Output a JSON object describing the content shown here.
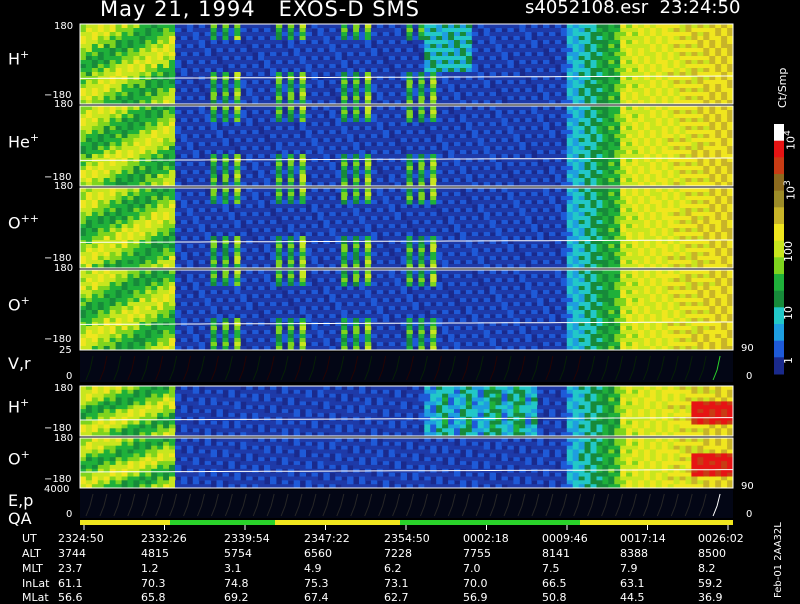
{
  "header": {
    "title": "May 21, 1994   EXOS-D SMS",
    "file_time": "s4052108.esr  23:24:50"
  },
  "colorbar": {
    "unit_label": "Ct/Smp",
    "tick_labels": [
      "1",
      "10",
      "100",
      "10",
      "10"
    ],
    "tick_exponents": [
      "",
      "",
      "",
      "3",
      "4"
    ],
    "colors": [
      "#1a2a8c",
      "#1e5ad8",
      "#1e9ee0",
      "#22c8c8",
      "#178a3a",
      "#1fb03a",
      "#7ed41e",
      "#c8e61e",
      "#f0e61e",
      "#c8b428",
      "#9c8c28",
      "#8c6a1e",
      "#c83c14",
      "#e61414",
      "#ffffff"
    ]
  },
  "panels": [
    {
      "label": "H",
      "sup": "+",
      "ymax": "180",
      "ymin": "−180"
    },
    {
      "label": "He",
      "sup": "+",
      "ymax": "180",
      "ymin": "−180"
    },
    {
      "label": "O",
      "sup": "++",
      "ymax": "180",
      "ymin": "−180"
    },
    {
      "label": "O",
      "sup": "+",
      "ymax": "180",
      "ymin": "−180"
    },
    {
      "label": "V,r",
      "sup": "",
      "ymax": "25",
      "ymin": "0",
      "right": "90",
      "right2": "0"
    },
    {
      "label": "H",
      "sup": "+",
      "ymax": "180",
      "ymin": "−180"
    },
    {
      "label": "O",
      "sup": "+",
      "ymax": "180",
      "ymin": "−180"
    },
    {
      "label": "E,p",
      "sup": "",
      "ymax": "4000",
      "ymin": "0",
      "right": "90",
      "right2": "0",
      "label2": "QA"
    }
  ],
  "table": {
    "row_labels": [
      "UT",
      "ALT",
      "MLT",
      "InLat",
      "MLat"
    ],
    "columns": [
      [
        "2324:50",
        "3744",
        "23.7",
        "61.1",
        "56.6"
      ],
      [
        "2332:26",
        "4815",
        "1.2",
        "70.3",
        "65.8"
      ],
      [
        "2339:54",
        "5754",
        "3.1",
        "74.8",
        "69.2"
      ],
      [
        "2347:22",
        "6560",
        "4.9",
        "75.3",
        "67.4"
      ],
      [
        "2354:50",
        "7228",
        "6.2",
        "73.1",
        "62.7"
      ],
      [
        "0002:18",
        "7755",
        "7.0",
        "70.0",
        "56.9"
      ],
      [
        "0009:46",
        "8141",
        "7.5",
        "66.5",
        "50.8"
      ],
      [
        "0017:14",
        "8388",
        "7.9",
        "63.1",
        "44.5"
      ],
      [
        "0026:02",
        "8500",
        "8.2",
        "59.2",
        "36.9"
      ]
    ]
  },
  "side_text": "Feb-01 2AA32L",
  "chart_data": {
    "type": "heatmap",
    "title": "May 21, 1994   EXOS-D SMS",
    "x": [
      "2324:50",
      "2332:26",
      "2339:54",
      "2347:22",
      "2354:50",
      "0002:18",
      "0009:46",
      "0017:14",
      "0026:02"
    ],
    "xlabel": "UT",
    "series": [
      {
        "name": "H+",
        "ylim": [
          -180,
          180
        ]
      },
      {
        "name": "He+",
        "ylim": [
          -180,
          180
        ]
      },
      {
        "name": "O++",
        "ylim": [
          -180,
          180
        ]
      },
      {
        "name": "O+",
        "ylim": [
          -180,
          180
        ]
      },
      {
        "name": "V,r",
        "ylim": [
          0,
          25
        ]
      },
      {
        "name": "H+",
        "ylim": [
          -180,
          180
        ]
      },
      {
        "name": "O+",
        "ylim": [
          -180,
          180
        ]
      },
      {
        "name": "E,p",
        "ylim": [
          0,
          4000
        ]
      }
    ],
    "colorscale": {
      "unit": "Ct/Smp",
      "range": [
        1,
        10000
      ],
      "scale": "log"
    }
  }
}
